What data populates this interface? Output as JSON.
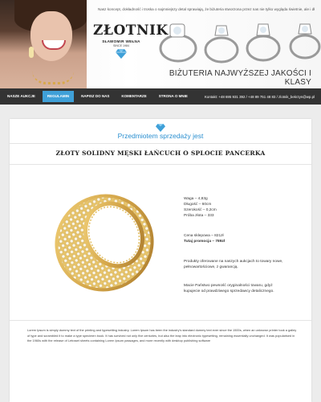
{
  "banner": {
    "intro_text": "Nasz koncept, dokładność i troska o najmniejszy detal sprawiają, że biżuteria stworzona przez nas nie tylko wygląda świetnie, ale i dłużej...",
    "logo_name": "ZŁOTNIK",
    "logo_owner": "SŁAWOMIR WEŁNA",
    "logo_since": "SINCE 1984",
    "tagline": "BIŻUTERIA NAJWYŻSZEJ JAKOŚCI I KLASY"
  },
  "nav": {
    "items": [
      {
        "label": "NASZE AUKCJE",
        "active": false
      },
      {
        "label": "REGULAMIN",
        "active": true
      },
      {
        "label": "NAPISZ DO NAS",
        "active": false
      },
      {
        "label": "KOMENTARZE",
        "active": false
      },
      {
        "label": "STRONA O MNIE",
        "active": false
      }
    ],
    "contact": "Kontakt: +48 695 931 392  /  +48 89 751 48 83  /  zlotnik_bekrzyn@wp.pl"
  },
  "section": {
    "title": "Przedmiotem sprzedaży jest"
  },
  "product": {
    "title": "ZŁOTY SOLIDNY MĘSKI ŁAŃCUCH O SPLOCIE PANCERKA",
    "specs": [
      "Waga – 4,83g",
      "Długość – 60cm",
      "Szerokość – 0,2cm",
      "Próba złota – 333"
    ],
    "price_regular": "Cena sklepowa – 821zł",
    "price_promo": "Tutaj promocja – 789zł",
    "description_1": "Produkty oferowane na naszych aukcjach to towary nowe, pełnowartościowe, z gwarancją.",
    "description_2": "Macie Państwo pewność oryginalności towaru, gdyż kupujecie od prawdziwego sprzedawcy detalicznego."
  },
  "lorem": "Lorem Ipsum is simply dummy text of the printing and typesetting industry. Lorem Ipsum has been the industry's standard dummy text ever since the 1500s, when an unknown printer took a galley of type and scrambled it to make a type specimen book. It has survived not only five centuries, but also the leap into electronic typesetting, remaining essentially unchanged. It was popularised in the 1960s with the release of Letraset sheets containing Lorem Ipsum passages, and more recently with desktop publishing software",
  "colors": {
    "accent": "#3fa0d8",
    "navbar": "#333333",
    "gold": "#d4a64a"
  }
}
